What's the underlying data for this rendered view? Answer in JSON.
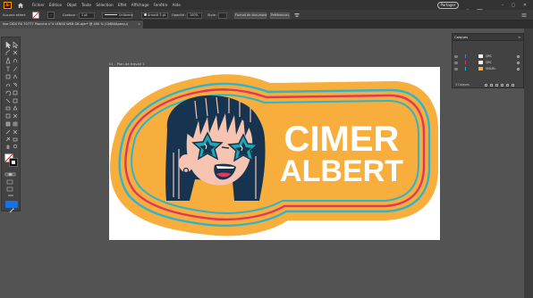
{
  "app": {
    "logo_text": "Ai"
  },
  "menus": [
    "Fichier",
    "Édition",
    "Objet",
    "Texte",
    "Sélection",
    "Effet",
    "Affichage",
    "Fenêtre",
    "Aide"
  ],
  "share_label": "Partager",
  "control_bar": {
    "selection_label": "Aucune sélect.",
    "stroke_label": "Contour :",
    "stroke_value": "1 pt",
    "style_value": "Uniforme",
    "brush_value": "Arrondi 5 pt",
    "opacity_label": "Opacité :",
    "opacity_value": "100%",
    "style_label": "Style :",
    "document_format_button": "Format de document",
    "preferences_button": "Préférences"
  },
  "doc_tab": {
    "title": "live CIDS RS 70777 Planche n°4 LENSS WEB OK.ajer* @ 400 % (CMJN/Aperçu)",
    "close": "×"
  },
  "artboard": {
    "label": "01 - Plan de travail 1",
    "logo_line1": "CIMER",
    "logo_line2": "ALBERT"
  },
  "colors": {
    "orange": "#f8ae3c",
    "cyan": "#2bb5cf",
    "magenta": "#e0375f",
    "navy": "#163350",
    "skin": "#f6c4b0",
    "teal_glasses": "#1fa8b4",
    "accent": "#1473e6"
  },
  "layers_panel": {
    "title": "Calques",
    "layers": [
      {
        "name": "QRC",
        "color": "#4b7fdc"
      },
      {
        "name": "QRC",
        "color": "#e0375f"
      },
      {
        "name": "VISUEL",
        "color": "#2bb5cf"
      }
    ],
    "footer": "3 Calques"
  }
}
